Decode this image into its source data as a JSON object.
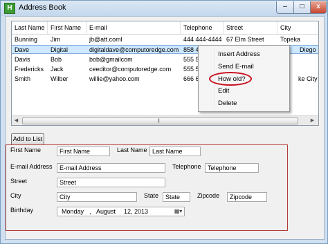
{
  "window": {
    "title": "Address Book",
    "app_icon_glyph": "H",
    "minimize": "–",
    "maximize": "□",
    "close": "x"
  },
  "list": {
    "columns": [
      "Last Name",
      "First Name",
      "E-mail",
      "Telephone",
      "Street",
      "City"
    ],
    "rows": [
      [
        "Bunning",
        "Jim",
        "jb@att.coml",
        "444 444-4444",
        "67 Elm Street",
        "Topeka"
      ],
      [
        "Dave",
        "Digital",
        "digitaldave@computoredge.com",
        "858 484",
        "",
        "Diego"
      ],
      [
        "Davis",
        "Bob",
        "bob@gmailcom",
        "555 555",
        "",
        ""
      ],
      [
        "Fredericks",
        "Jack",
        "ceeditor@computoredge.com",
        "555 555",
        "",
        ""
      ],
      [
        "Smith",
        "Wilber",
        "willie@yahoo.com",
        "666 666",
        "",
        "ke City"
      ]
    ],
    "selected_row": 1,
    "scroll_grip": "|||"
  },
  "context_menu": {
    "items": [
      "Insert Address",
      "Send E-mail",
      "How old?",
      "Edit",
      "Delete"
    ],
    "highlighted_item": "How old?"
  },
  "add_button_label": "Add to List",
  "form": {
    "first_name": {
      "label": "First Name",
      "value": "First Name"
    },
    "last_name": {
      "label": "Last Name",
      "value": "Last Name"
    },
    "email": {
      "label": "E-mail Address",
      "value": "E-mail Address"
    },
    "telephone": {
      "label": "Telephone",
      "value": "Telephone"
    },
    "street": {
      "label": "Street",
      "value": "Street"
    },
    "city": {
      "label": "City",
      "value": "City"
    },
    "state": {
      "label": "State",
      "value": "State"
    },
    "zipcode": {
      "label": "Zipcode",
      "value": "Zipcode"
    },
    "birthday": {
      "label": "Birthday",
      "weekday": "Monday",
      "sep": ",",
      "month": "August",
      "day": "12, 2013",
      "dropdown_glyph": "▦▾"
    }
  },
  "colors": {
    "selection": "#cde8ff",
    "highlight_ring": "#c8101e",
    "form_border": "#b23a3a",
    "titlebar": "#c3d7ec"
  },
  "icons": [
    "app-icon",
    "chevron-left-icon",
    "chevron-right-icon",
    "calendar-icon"
  ]
}
